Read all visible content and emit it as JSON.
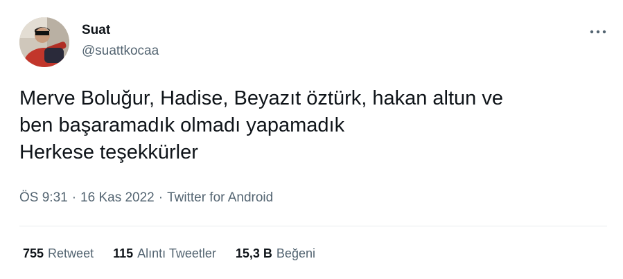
{
  "author": {
    "display_name": "Suat",
    "handle": "@suattkocaa",
    "avatar_icon": "profile-photo"
  },
  "more_icon": "more-horizontal-icon",
  "tweet": {
    "text": "Merve Boluğur, Hadise, Beyazıt öztürk, hakan altun ve\nben başaramadık olmadı yapamadık\nHerkese teşekkürler"
  },
  "meta": {
    "time": "ÖS 9:31",
    "separator": "·",
    "date": "16 Kas 2022",
    "source": "Twitter for Android"
  },
  "stats": {
    "retweets": {
      "count": "755",
      "label": "Retweet"
    },
    "quotes": {
      "count": "115",
      "label": "Alıntı Tweetler"
    },
    "likes": {
      "count": "15,3 B",
      "label": "Beğeni"
    }
  },
  "colors": {
    "text_primary": "#0f1419",
    "text_secondary": "#536471",
    "divider": "#e8ebed"
  }
}
